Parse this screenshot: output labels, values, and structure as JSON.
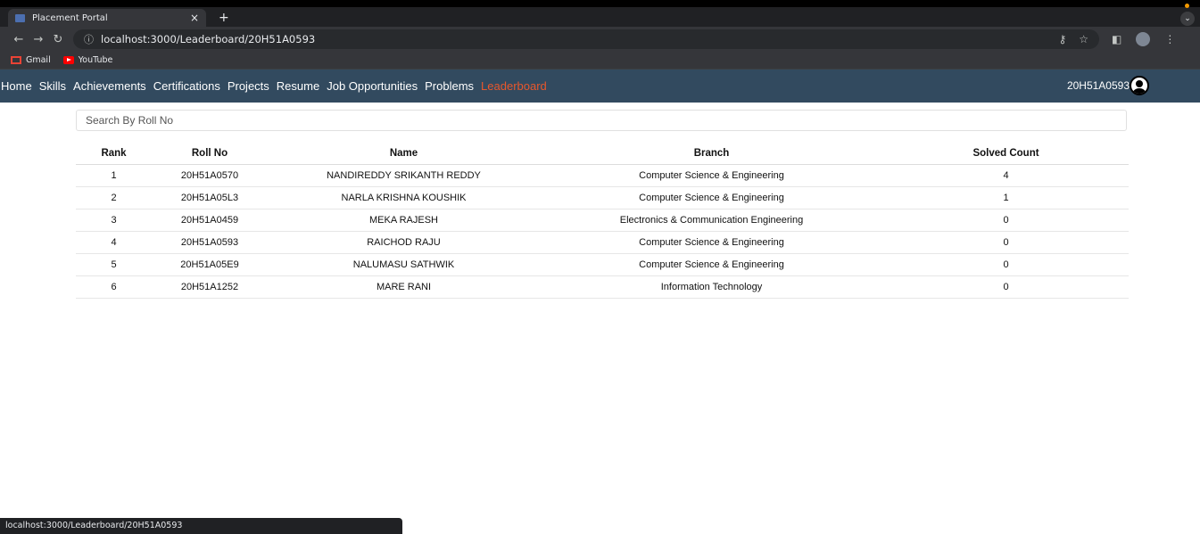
{
  "browser": {
    "tab_title": "Placement Portal",
    "tab_close": "×",
    "new_tab": "+",
    "url": "localhost:3000/Leaderboard/20H51A0593",
    "bookmarks": [
      "Gmail",
      "YouTube"
    ],
    "status_url": "localhost:3000/Leaderboard/20H51A0593"
  },
  "nav": {
    "items": [
      "Home",
      "Skills",
      "Achievements",
      "Certifications",
      "Projects",
      "Resume",
      "Job Opportunities",
      "Problems",
      "Leaderboard"
    ],
    "active": "Leaderboard",
    "user_id": "20H51A0593",
    "active_color": "#e8572c",
    "bar_color": "#324a5f"
  },
  "search": {
    "placeholder": "Search By Roll No"
  },
  "table": {
    "headers": [
      "Rank",
      "Roll No",
      "Name",
      "Branch",
      "Solved Count"
    ],
    "rows": [
      [
        "1",
        "20H51A0570",
        "NANDIREDDY SRIKANTH REDDY",
        "Computer Science & Engineering",
        "4"
      ],
      [
        "2",
        "20H51A05L3",
        "NARLA KRISHNA KOUSHIK",
        "Computer Science & Engineering",
        "1"
      ],
      [
        "3",
        "20H51A0459",
        "MEKA RAJESH",
        "Electronics & Communication Engineering",
        "0"
      ],
      [
        "4",
        "20H51A0593",
        "RAICHOD RAJU",
        "Computer Science & Engineering",
        "0"
      ],
      [
        "5",
        "20H51A05E9",
        "NALUMASU SATHWIK",
        "Computer Science & Engineering",
        "0"
      ],
      [
        "6",
        "20H51A1252",
        "MARE RANI",
        "Information Technology",
        "0"
      ]
    ]
  }
}
